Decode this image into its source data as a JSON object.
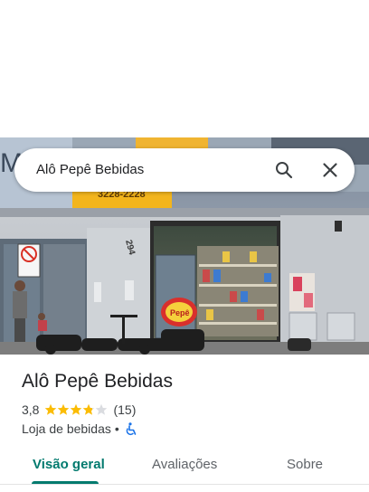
{
  "search": {
    "query": "Alô Pepê Bebidas",
    "search_icon": "search-icon",
    "close_icon": "close-icon"
  },
  "photo": {
    "description_icon": "storefront-photo",
    "signage": {
      "building_number": "294",
      "pepe_logo": "Pepê",
      "partial_sign_top": "Mako",
      "partial_phone": "3228-2228"
    }
  },
  "place": {
    "name": "Alô Pepê Bebidas",
    "rating": "3,8",
    "stars_fraction": 0.76,
    "review_count": "(15)",
    "category": "Loja de bebidas",
    "separator": "•",
    "accessibility_icon": "wheelchair-icon"
  },
  "tabs": [
    {
      "label": "Visão geral",
      "active": true
    },
    {
      "label": "Avaliações",
      "active": false
    },
    {
      "label": "Sobre",
      "active": false
    }
  ],
  "colors": {
    "accent": "#017a6e",
    "star": "#fbbc04",
    "star_empty": "#dadce0",
    "accessibility": "#1a73e8"
  }
}
